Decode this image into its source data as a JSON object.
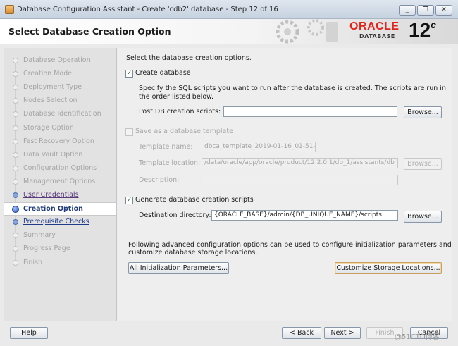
{
  "window": {
    "title": "Database Configuration Assistant - Create 'cdb2' database - Step 12 of 16",
    "buttons": {
      "minimize": "_",
      "restore": "❐",
      "close": "✕"
    }
  },
  "header": {
    "page_title": "Select Database Creation Option",
    "brand": "ORACLE",
    "brand_sub": "DATABASE",
    "version": "12",
    "version_suffix": "c"
  },
  "sidebar": {
    "items": [
      {
        "label": "Database Operation",
        "state": "disabled"
      },
      {
        "label": "Creation Mode",
        "state": "disabled"
      },
      {
        "label": "Deployment Type",
        "state": "disabled"
      },
      {
        "label": "Nodes Selection",
        "state": "disabled"
      },
      {
        "label": "Database Identification",
        "state": "disabled"
      },
      {
        "label": "Storage Option",
        "state": "disabled"
      },
      {
        "label": "Fast Recovery Option",
        "state": "disabled"
      },
      {
        "label": "Data Vault Option",
        "state": "disabled"
      },
      {
        "label": "Configuration Options",
        "state": "disabled"
      },
      {
        "label": "Management Options",
        "state": "disabled"
      },
      {
        "label": "User Credentials",
        "state": "visited"
      },
      {
        "label": "Creation Option",
        "state": "active"
      },
      {
        "label": "Prerequisite Checks",
        "state": "link"
      },
      {
        "label": "Summary",
        "state": "disabled"
      },
      {
        "label": "Progress Page",
        "state": "disabled"
      },
      {
        "label": "Finish",
        "state": "disabled"
      }
    ]
  },
  "main": {
    "intro": "Select the database creation options.",
    "create_db": {
      "label": "Create database",
      "checked": true,
      "desc_line1": "Specify the SQL scripts you want to run after the database is created. The scripts are run in",
      "desc_line2": "the order listed below.",
      "post_label": "Post DB creation scripts:",
      "post_value": "",
      "browse": "Browse..."
    },
    "template": {
      "label": "Save as a database template",
      "checked": false,
      "name_label": "Template name:",
      "name_value": "dbca_template_2019-01-16_01-51-4",
      "location_label": "Template location:",
      "location_value": "/data/oracle/app/oracle/product/12.2.0.1/db_1/assistants/db",
      "browse": "Browse...",
      "desc_label": "Description:",
      "desc_value": ""
    },
    "scripts": {
      "label": "Generate database creation scripts",
      "checked": true,
      "dest_label": "Destination directory:",
      "dest_value": "{ORACLE_BASE}/admin/{DB_UNIQUE_NAME}/scripts",
      "browse": "Browse..."
    },
    "advanced": {
      "line1": "Following advanced configuration options can be used to configure initialization parameters and",
      "line2": "customize database storage locations.",
      "init_params": "All Initialization Parameters...",
      "storage": "Customize Storage Locations..."
    }
  },
  "footer": {
    "help": "Help",
    "back": "< Back",
    "next": "Next >",
    "finish": "Finish",
    "cancel": "Cancel",
    "watermark": "@51CTO博客"
  }
}
